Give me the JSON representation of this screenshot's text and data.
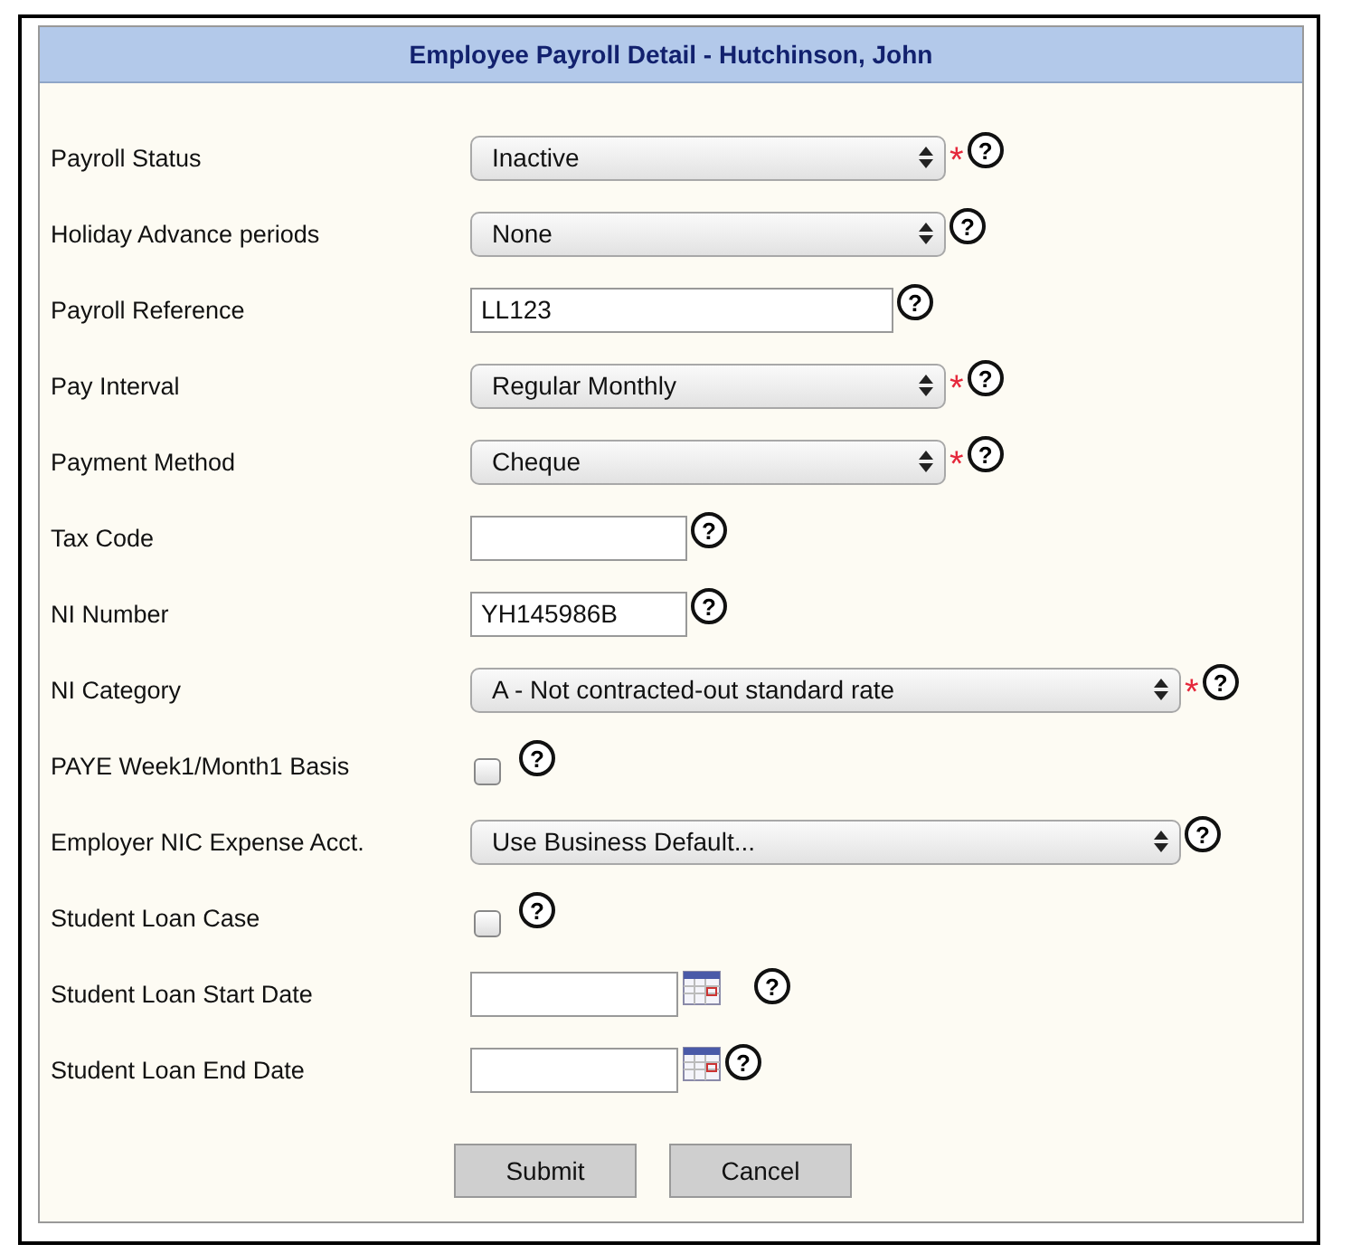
{
  "panel": {
    "title": "Employee Payroll Detail - Hutchinson, John"
  },
  "fields": [
    {
      "kind": "select",
      "label": "Payroll Status",
      "value": "Inactive",
      "required": "*",
      "help": "?"
    },
    {
      "kind": "select",
      "label": "Holiday Advance periods",
      "value": "None",
      "help": "?"
    },
    {
      "kind": "text",
      "label": "Payroll Reference",
      "value": "LL123",
      "help": "?"
    },
    {
      "kind": "select",
      "label": "Pay Interval",
      "value": "Regular Monthly",
      "required": "*",
      "help": "?"
    },
    {
      "kind": "select",
      "label": "Payment Method",
      "value": "Cheque",
      "required": "*",
      "help": "?"
    },
    {
      "kind": "short-text",
      "label": "Tax Code",
      "help": "?"
    },
    {
      "kind": "short-text",
      "label": "NI Number",
      "value": "YH145986B",
      "help": "?"
    },
    {
      "kind": "long-select",
      "label": "NI Category",
      "value": "A - Not contracted-out standard rate",
      "required": "*",
      "help": "?"
    },
    {
      "kind": "checkbox",
      "label": "PAYE Week1/Month1 Basis",
      "checked": false,
      "help": "?"
    },
    {
      "kind": "long-select",
      "label": "Employer NIC Expense Acct.",
      "value": "Use Business Default...",
      "help": "?"
    },
    {
      "kind": "checkbox",
      "label": "Student Loan Case",
      "checked": false,
      "help": "?"
    },
    {
      "kind": "date",
      "label": "Student Loan Start Date",
      "help": "?"
    },
    {
      "kind": "date",
      "label": "Student Loan End Date",
      "help": "?"
    }
  ],
  "buttons": [
    "Submit",
    "Cancel"
  ]
}
